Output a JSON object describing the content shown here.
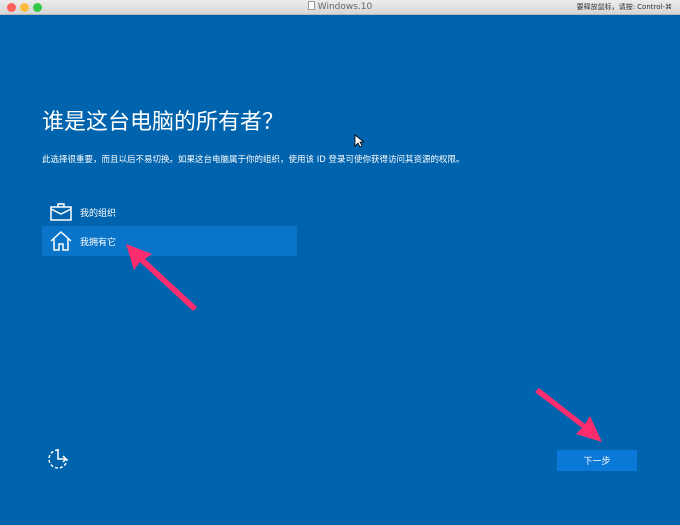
{
  "window": {
    "title": "Windows.10",
    "hint": "要释放鼠标，请按: Control-⌘"
  },
  "page": {
    "heading": "谁是这台电脑的所有者？",
    "description": "此选择很重要，而且以后不易切换。如果这台电脑属于你的组织，使用该 ID 登录可使你获得访问其资源的权限。"
  },
  "options": [
    {
      "label": "我的组织",
      "icon": "briefcase-icon",
      "selected": false
    },
    {
      "label": "我拥有它",
      "icon": "home-icon",
      "selected": true
    }
  ],
  "buttons": {
    "next": "下一步"
  },
  "colors": {
    "background": "#0063ad",
    "selected": "#0a74c9",
    "button": "#0a78d7",
    "annotation": "#ff2d6e"
  }
}
